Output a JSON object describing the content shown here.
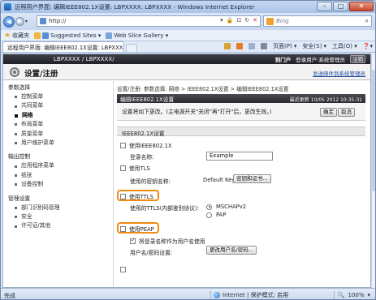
{
  "window": {
    "title": "远程用户界面: 编辑IEEE802.1X设置: LBPXXXX: LBPXXXX - Windows Internet Explorer",
    "min": "–",
    "max": "□",
    "close": "✕"
  },
  "address": {
    "url": "http://",
    "search_placeholder": "Bing"
  },
  "favorites": {
    "label": "收藏夹",
    "suggested": "Suggested Sites ▾",
    "web_slice": "Web Slice Gallery ▾"
  },
  "tab": {
    "label": "远程用户界面: 编辑IEEE802.1X设置: LBPXXXX: L...",
    "close": "✕"
  },
  "commands": {
    "page": "页面(P) ▾",
    "safety": "安全(S) ▾",
    "tools": "工具(O) ▾",
    "help": "❓▾"
  },
  "page": {
    "printer_name": "LBPXXXX / LBPXXXX/",
    "portal_link": "到门户",
    "login_user": "登录用户:系统管理员",
    "logout": "注销",
    "header_title": "设置/注册",
    "mail_admin": "发送邮件到系统管理员"
  },
  "sidebar": {
    "sections": [
      {
        "title": "参数选择",
        "items": [
          {
            "label": "控制菜单",
            "active": false
          },
          {
            "label": "共同菜单",
            "active": false
          },
          {
            "label": "网络",
            "active": true
          },
          {
            "label": "布局菜单",
            "active": false
          },
          {
            "label": "质量菜单",
            "active": false
          },
          {
            "label": "用户维护菜单",
            "active": false
          }
        ]
      },
      {
        "title": "输出控制",
        "items": [
          {
            "label": "应用程序菜单",
            "active": false
          },
          {
            "label": "纸张",
            "active": false
          },
          {
            "label": "设备控制",
            "active": false
          }
        ]
      },
      {
        "title": "管理设置",
        "items": [
          {
            "label": "部门识别码管理",
            "active": false
          },
          {
            "label": "安全",
            "active": false
          },
          {
            "label": "许可证/其他",
            "active": false
          }
        ]
      }
    ]
  },
  "main": {
    "breadcrumb": "设置/注册: 参数选择: 网络 > IEEE802.1X设置 > 编辑IEEE802.1X设置",
    "band_title": "编辑IEEE802.1X设置",
    "last_updated": "最近更新 10/05 2012 10:35:31",
    "notice": "设置将如下更改。(主电源开关\"关闭\"再\"打开\"后，更改生效。)",
    "ok": "确定",
    "cancel": "取消",
    "section_title": "IEEE802.1X设置",
    "use_ieee": "使用IEEE802.1X",
    "login_name_label": "登录名称:",
    "login_name_value": "Example",
    "use_tls": "使用TLS",
    "key_label": "使用的密钥名称:",
    "key_value": "Default Key",
    "key_button": "密钥和证书...",
    "use_ttls": "使用TTLS",
    "ttls_label": "使用的TTLS(内部鉴别协议):",
    "mschap": "MSCHAPv2",
    "pap": "PAP",
    "use_peap": "使用PEAP",
    "use_login_as_user": "将登录名称作为用户名使用",
    "user_pwd_label": "用户名/密码设置:",
    "user_pwd_button": "更改用户名/密码..."
  },
  "status": {
    "done": "完成",
    "zone": "Internet | 保护模式: 启用",
    "zoom": "100%"
  },
  "colors": {
    "highlight": "#f08a10",
    "dark_band": "#2a2a30"
  }
}
